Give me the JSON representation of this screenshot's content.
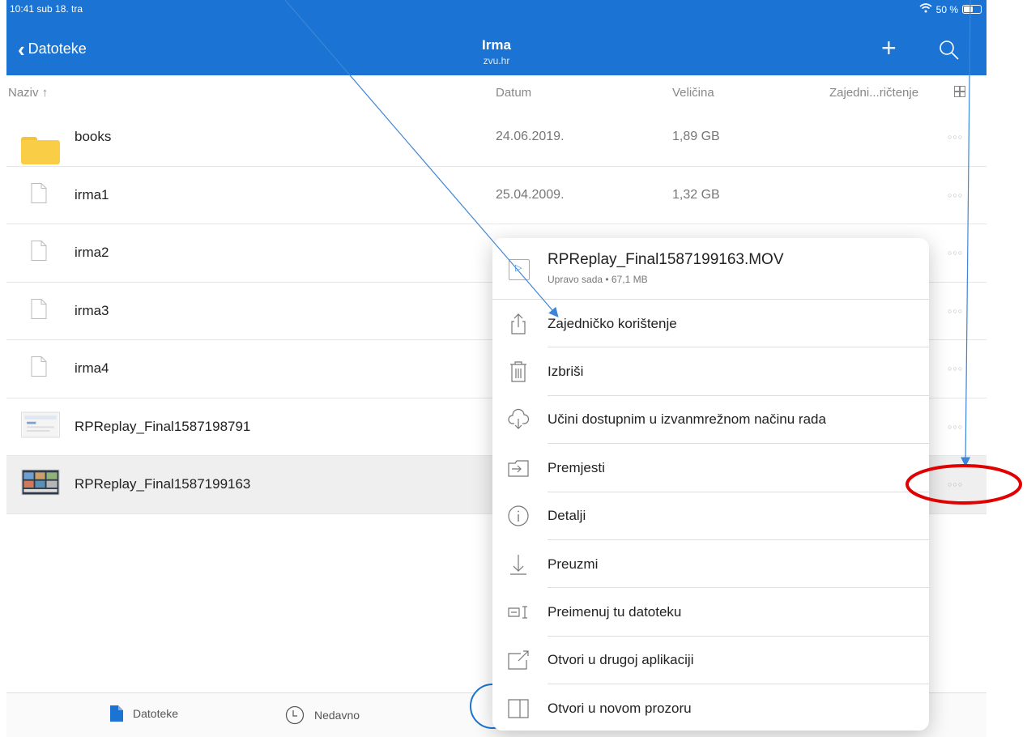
{
  "status_bar": {
    "time_date": "10:41  sub 18. tra",
    "battery": "50 %",
    "battery_level": 0.5
  },
  "header": {
    "back_label": "Datoteke",
    "title": "Irma",
    "subtitle": "zvu.hr"
  },
  "columns": {
    "name": "Naziv  ↑",
    "date": "Datum",
    "size": "Veličina",
    "shared": "Zajedni...ričtenje"
  },
  "files": [
    {
      "name": "books",
      "date": "24.06.2019.",
      "size": "1,89 GB",
      "icon": "folder-icon"
    },
    {
      "name": "irma1",
      "date": "25.04.2009.",
      "size": "1,32 GB",
      "icon": "document-icon"
    },
    {
      "name": "irma2",
      "date": "",
      "size": "",
      "icon": "document-icon"
    },
    {
      "name": "irma3",
      "date": "",
      "size": "",
      "icon": "document-icon"
    },
    {
      "name": "irma4",
      "date": "",
      "size": "",
      "icon": "document-icon"
    },
    {
      "name": "RPReplay_Final1587198791",
      "date": "",
      "size": "",
      "icon": "video-thumbnail"
    },
    {
      "name": "RPReplay_Final1587199163",
      "date": "",
      "size": "",
      "icon": "video-thumbnail"
    }
  ],
  "popover": {
    "file_name": "RPReplay_Final1587199163.MOV",
    "file_meta": "Upravo sada • 67,1 MB",
    "items": [
      {
        "label": "Zajedničko korištenje",
        "icon": "share-icon"
      },
      {
        "label": "Izbriši",
        "icon": "trash-icon"
      },
      {
        "label": "Učini dostupnim u izvanmrežnom načinu rada",
        "icon": "cloud-download-icon"
      },
      {
        "label": "Premjesti",
        "icon": "move-icon"
      },
      {
        "label": "Detalji",
        "icon": "info-icon"
      },
      {
        "label": "Preuzmi",
        "icon": "download-icon"
      },
      {
        "label": "Preimenuj tu datoteku",
        "icon": "rename-icon"
      },
      {
        "label": "Otvori u drugoj aplikaciji",
        "icon": "open-in-app-icon"
      },
      {
        "label": "Otvori u novom prozoru",
        "icon": "new-window-icon"
      }
    ]
  },
  "tabbar": {
    "files_label": "Datoteke",
    "recent_label": "Nedavno"
  },
  "colors": {
    "accent": "#1b74d3",
    "folder": "#f9cd45",
    "annotation_arrow": "#3d85d6",
    "annotation_circle": "#e00000"
  }
}
